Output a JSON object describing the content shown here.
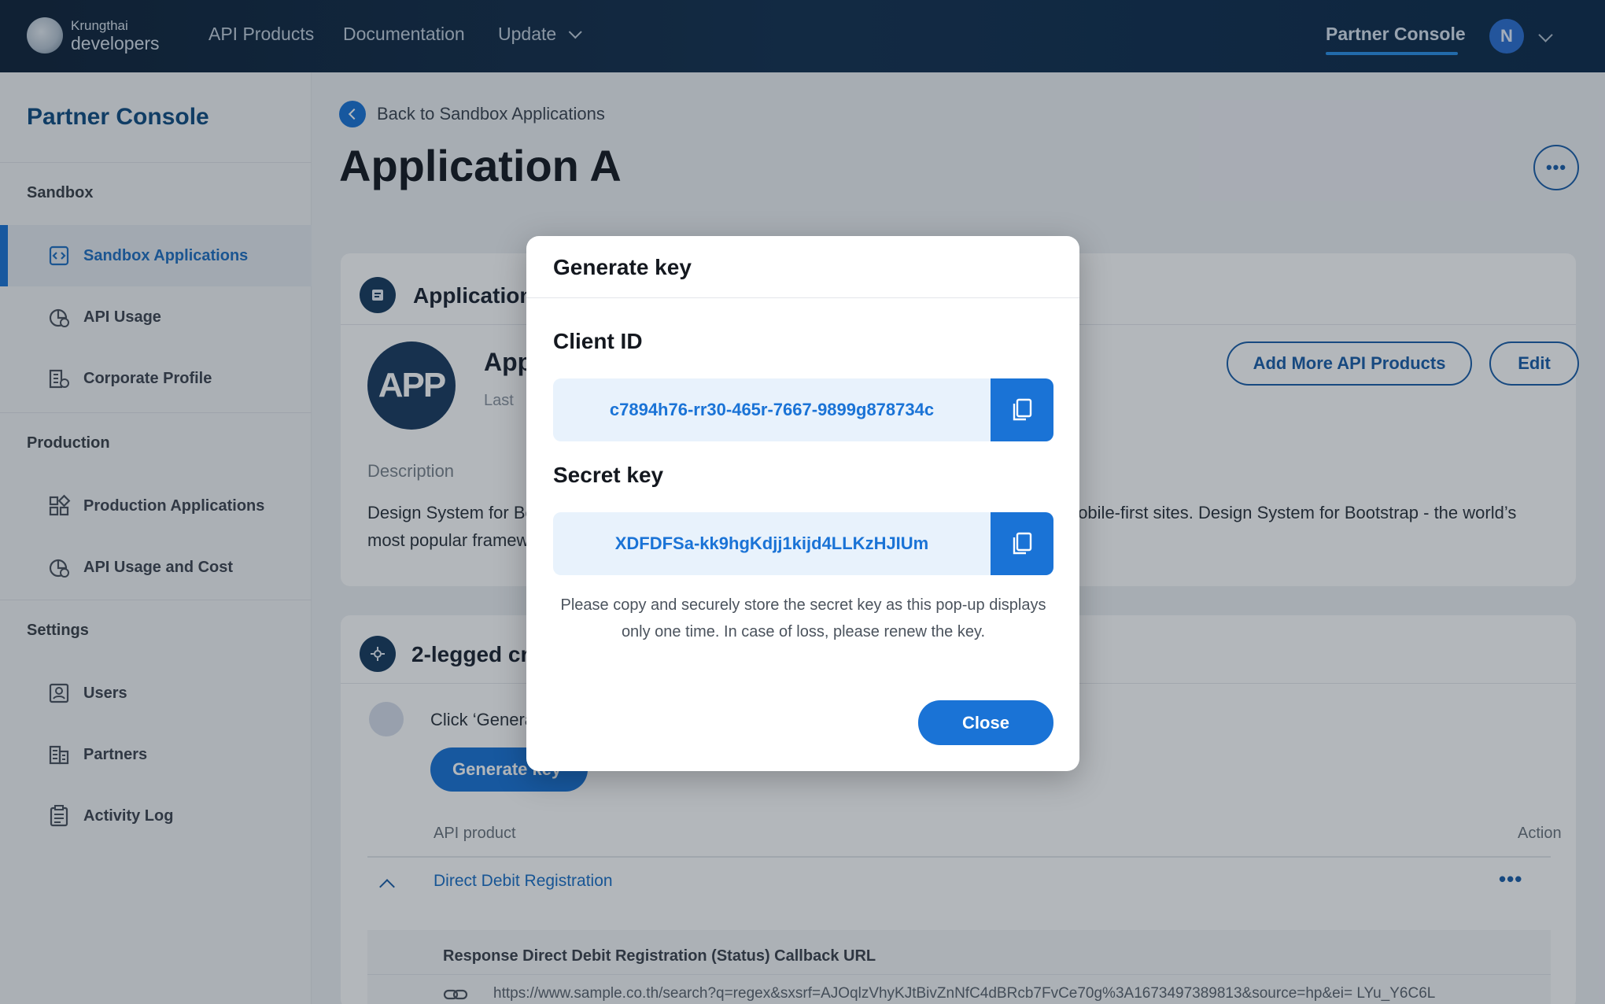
{
  "header": {
    "brand_small": "Krungthai",
    "brand_big": "developers",
    "nav": [
      "API Products",
      "Documentation",
      "Update"
    ],
    "partner_console": "Partner Console",
    "avatar_initial": "N"
  },
  "sidebar": {
    "title": "Partner Console",
    "sections": {
      "sandbox": "Sandbox",
      "production": "Production",
      "settings": "Settings"
    },
    "items": {
      "sandbox_applications": "Sandbox Applications",
      "api_usage": "API Usage",
      "corporate_profile": "Corporate Profile",
      "production_applications": "Production Applications",
      "api_usage_and_cost": "API Usage and Cost",
      "users": "Users",
      "partners": "Partners",
      "activity_log": "Activity Log"
    }
  },
  "main": {
    "back_link": "Back to Sandbox Applications",
    "title": "Application A",
    "more_label": "•••",
    "app_card": {
      "heading": "Application",
      "logo_text": "APP",
      "app_name": "App",
      "last_label": "Last",
      "add_more_button": "Add More API Products",
      "edit_button": "Edit",
      "description_label": "Description",
      "description_text": "Design System for Bootstrap - the world’s most popular framework for building responsive, mobile-first sites. Design System for Bootstrap - the world’s most popular framework for building responsive, mobile-first sites."
    },
    "cred_card": {
      "heading": "2-legged credentials",
      "hint": "Click ‘Generate key’",
      "generate_button": "Generate key",
      "col_api_product": "API product",
      "col_action": "Action",
      "row_name": "Direct Debit Registration",
      "row_dots": "•••",
      "callback_label": "Response Direct Debit Registration (Status) Callback URL",
      "callback_url": "https://www.sample.co.th/search?q=regex&sxsrf=AJOqlzVhyKJtBivZnNfC4dBRcb7FvCe70g%3A1673497389813&source=hp&ei= LYu_Y6C6L"
    }
  },
  "modal": {
    "title": "Generate key",
    "client_id_label": "Client ID",
    "client_id_value": "c7894h76-rr30-465r-7667-9899g878734c",
    "secret_key_label": "Secret key",
    "secret_key_value": "XDFDFSa-kk9hgKdjj1kijd4LLKzHJIUm",
    "note": "Please copy and securely store the secret key as this pop-up displays only one time. In case of loss, please renew the key.",
    "close_button": "Close"
  },
  "colors": {
    "primary": "#1a73d6",
    "navy": "#13304f",
    "key_bg": "#e8f2fc"
  }
}
